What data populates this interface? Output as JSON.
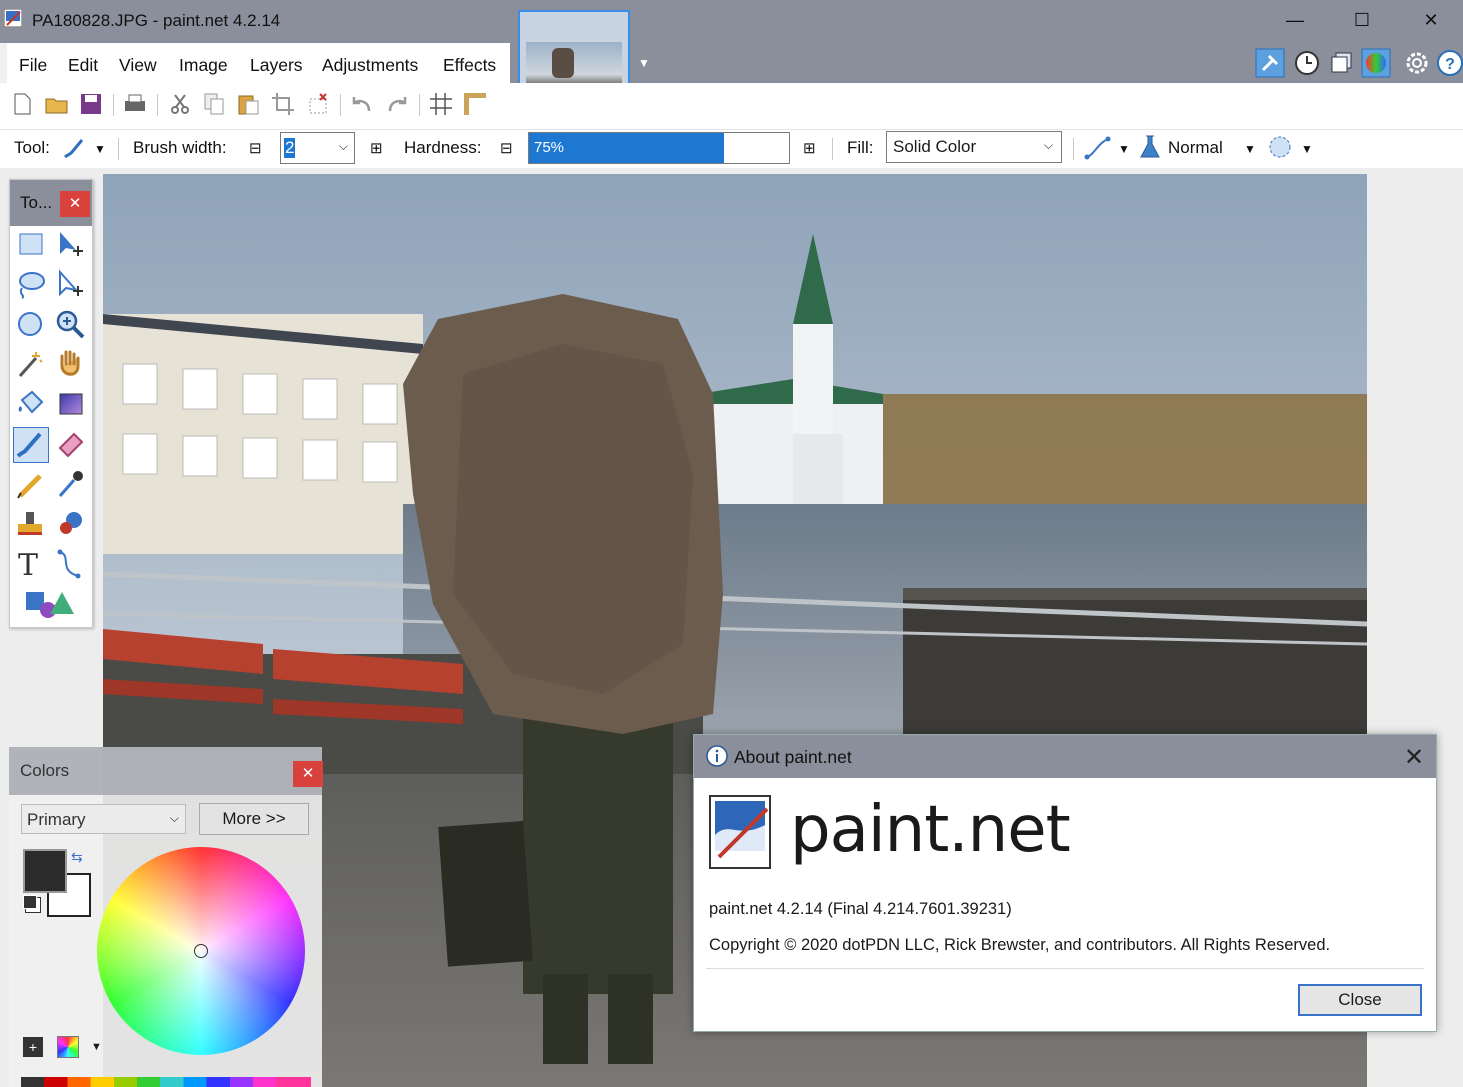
{
  "window": {
    "title": "PA180828.JPG - paint.net 4.2.14"
  },
  "menu": [
    "File",
    "Edit",
    "View",
    "Image",
    "Layers",
    "Adjustments",
    "Effects"
  ],
  "tool_options": {
    "tool_label": "Tool:",
    "brush_width_label": "Brush width:",
    "brush_width_value": "2",
    "hardness_label": "Hardness:",
    "hardness_value": "75%",
    "hardness_fraction": 0.75,
    "fill_label": "Fill:",
    "fill_value": "Solid Color",
    "blend_mode": "Normal"
  },
  "tools_panel": {
    "title": "To...",
    "close": "✕"
  },
  "colors_panel": {
    "title": "Colors",
    "close": "✕",
    "mode_select": "Primary",
    "more_button": "More >>",
    "primary_color": "#2b2b2b",
    "secondary_color": "#ffffff"
  },
  "about": {
    "title": "About paint.net",
    "brand": "paint.net",
    "version": "paint.net 4.2.14 (Final 4.214.7601.39231)",
    "copyright": "Copyright © 2020 dotPDN LLC, Rick Brewster, and contributors. All Rights Reserved.",
    "close_button": "Close"
  },
  "colors": {
    "titlebar": "#8a8f9b",
    "accent": "#3a8ee6",
    "hardness_fill": "#1e78d2",
    "close_red": "#d9413c"
  }
}
